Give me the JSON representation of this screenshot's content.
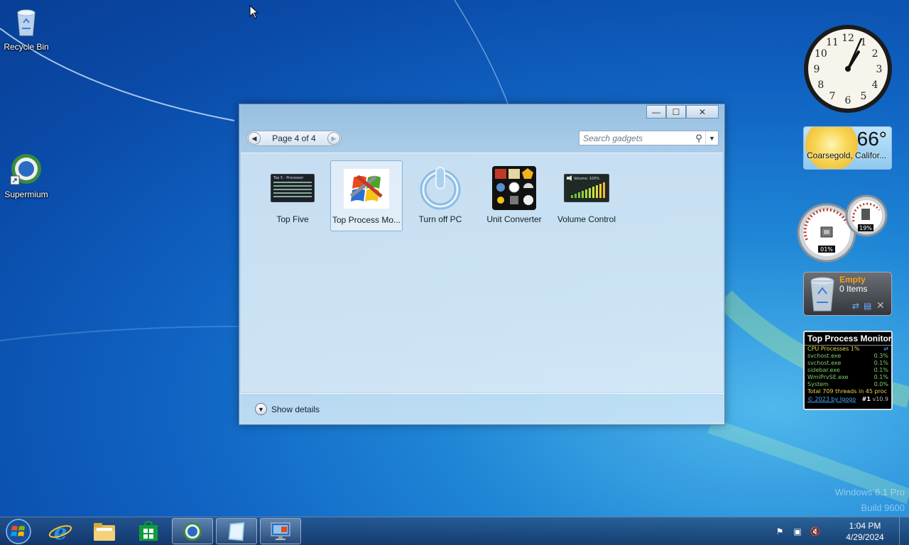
{
  "desktop": {
    "icons": [
      {
        "label": "Recycle Bin"
      },
      {
        "label": "Supermium"
      }
    ],
    "watermark": {
      "line1": "Windows 8.1 Pro",
      "line2": "Build 9600"
    }
  },
  "gadget_window": {
    "pager": {
      "text": "Page 4 of 4"
    },
    "search": {
      "placeholder": "Search gadgets"
    },
    "gadgets": [
      {
        "label": "Top Five",
        "selected": false
      },
      {
        "label": "Top Process Mo...",
        "selected": true
      },
      {
        "label": "Turn off PC",
        "selected": false
      },
      {
        "label": "Unit Converter",
        "selected": false
      },
      {
        "label": "Volume Control",
        "selected": false
      }
    ],
    "details_label": "Show details",
    "controls": {
      "minimize": "—",
      "maximize": "☐",
      "close": "✕"
    },
    "thumbs": {
      "top_five_title": "Top 5 - Processor",
      "volume_text": "Volume: 100%"
    }
  },
  "side_gadgets": {
    "clock": {
      "hour": 1,
      "minute": 4,
      "numerals": [
        "12",
        "1",
        "2",
        "3",
        "4",
        "5",
        "6",
        "7",
        "8",
        "9",
        "10",
        "11"
      ]
    },
    "weather": {
      "temp": "66°",
      "city": "Coarsegold, Califor..."
    },
    "meters": {
      "cpu": "01%",
      "ram": "19%"
    },
    "recycle": {
      "status": "Empty",
      "items": "0 Items"
    },
    "top_process_monitor": {
      "title": "Top Process Monitor",
      "cpu_line": "CPU Processes 1%",
      "rows": [
        {
          "name": "svchost.exe",
          "value": "0.3%"
        },
        {
          "name": "svchost.exe",
          "value": "0.1%"
        },
        {
          "name": "sidebar.exe",
          "value": "0.1%"
        },
        {
          "name": "WmiPrvSE.exe",
          "value": "0.1%"
        },
        {
          "name": "System",
          "value": "0.0%"
        }
      ],
      "total": "Total 709 threads in 45 proc",
      "link": "© 2023 by Igogo",
      "rank": "#1",
      "version": "v10.9"
    }
  },
  "taskbar": {
    "time": "1:04 PM",
    "date": "4/29/2024",
    "apps": [
      "internet-explorer",
      "file-explorer",
      "store",
      "supermium",
      "gadget-gallery",
      "remote-desktop"
    ]
  },
  "colors": {
    "accent": "#1f86d6",
    "taskbar": "#1d3c66"
  }
}
